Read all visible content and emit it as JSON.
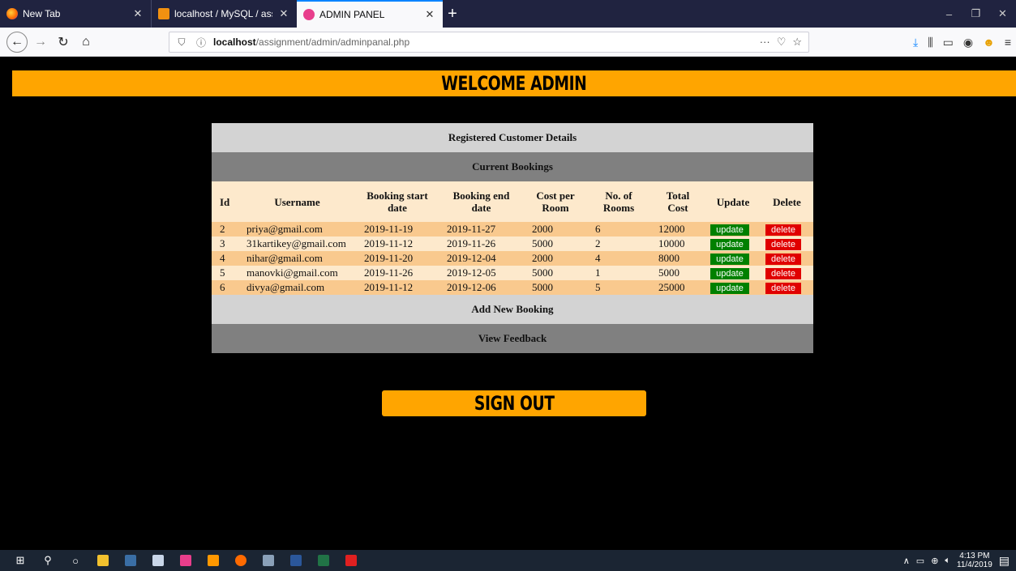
{
  "browser": {
    "tabs": [
      {
        "title": "New Tab",
        "close": "✕"
      },
      {
        "title": "localhost / MySQL / assignmen",
        "close": "✕"
      },
      {
        "title": "ADMIN PANEL",
        "close": "✕"
      }
    ],
    "new_tab": "+",
    "url_host": "localhost",
    "url_path": "/assignment/admin/adminpanal.php",
    "url_actions": "···"
  },
  "page": {
    "welcome": "WELCOME ADMIN",
    "registered": "Registered Customer Details",
    "current_bookings": "Current Bookings",
    "columns": {
      "id": "Id",
      "username": "Username",
      "start1": "Booking start",
      "start2": "date",
      "end1": "Booking end",
      "end2": "date",
      "cost1": "Cost per",
      "cost2": "Room",
      "rooms1": "No. of",
      "rooms2": "Rooms",
      "total1": "Total",
      "total2": "Cost",
      "update": "Update",
      "delete": "Delete"
    },
    "rows": [
      {
        "id": "2",
        "username": "priya@gmail.com",
        "start": "2019-11-19",
        "end": "2019-11-27",
        "cost": "2000",
        "rooms": "6",
        "total": "12000",
        "update": "update",
        "delete": "delete"
      },
      {
        "id": "3",
        "username": "31kartikey@gmail.com",
        "start": "2019-11-12",
        "end": "2019-11-26",
        "cost": "5000",
        "rooms": "2",
        "total": "10000",
        "update": "update",
        "delete": "delete"
      },
      {
        "id": "4",
        "username": "nihar@gmail.com",
        "start": "2019-11-20",
        "end": "2019-12-04",
        "cost": "2000",
        "rooms": "4",
        "total": "8000",
        "update": "update",
        "delete": "delete"
      },
      {
        "id": "5",
        "username": "manovki@gmail.com",
        "start": "2019-11-26",
        "end": "2019-12-05",
        "cost": "5000",
        "rooms": "1",
        "total": "5000",
        "update": "update",
        "delete": "delete"
      },
      {
        "id": "6",
        "username": "divya@gmail.com",
        "start": "2019-11-12",
        "end": "2019-12-06",
        "cost": "5000",
        "rooms": "5",
        "total": "25000",
        "update": "update",
        "delete": "delete"
      }
    ],
    "add_booking": "Add New Booking",
    "view_feedback": "View Feedback",
    "sign_out": "SIGN OUT"
  },
  "taskbar": {
    "time": "4:13 PM",
    "date": "11/4/2019"
  },
  "colors": {
    "accent": "#ffa500",
    "update_btn": "#008000",
    "delete_btn": "#e00000",
    "row_odd": "#f9c98e",
    "row_even": "#fde9cc"
  }
}
